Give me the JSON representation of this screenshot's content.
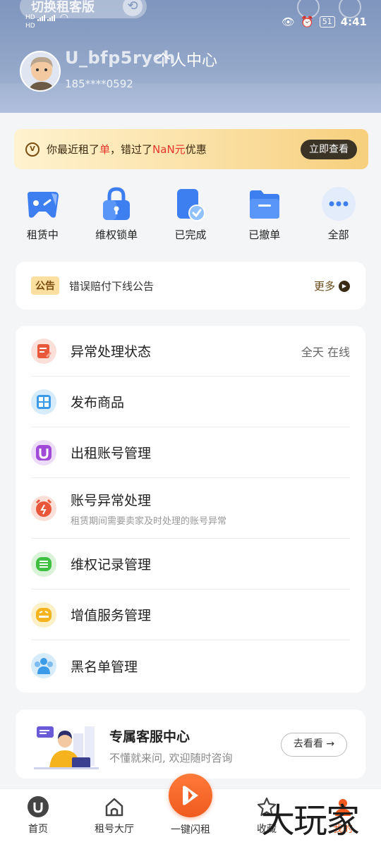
{
  "status_bar": {
    "time": "4:41",
    "battery": "51",
    "network_top": "HD",
    "network_bottom": "HD"
  },
  "header": {
    "switch_label": "切换租客版",
    "username": "U_bfp5rych",
    "title": "个人中心",
    "phone": "185****0592"
  },
  "promo": {
    "text_prefix": "你最近租了",
    "text_red1": "单",
    "text_mid": "，错过了",
    "text_red2": "NaN元",
    "text_suffix": "优惠",
    "button": "立即查看",
    "icon_label": "V"
  },
  "quick_actions": [
    {
      "label": "租赁中",
      "icon": "gamepad-icon"
    },
    {
      "label": "维权锁单",
      "icon": "lock-icon"
    },
    {
      "label": "已完成",
      "icon": "check-document-icon"
    },
    {
      "label": "已撤单",
      "icon": "folder-icon"
    },
    {
      "label": "全部",
      "icon": "more-dots-icon"
    }
  ],
  "notice": {
    "tag": "公告",
    "text": "错误赔付下线公告",
    "more": "更多"
  },
  "menu": [
    {
      "label": "异常处理状态",
      "right": "全天 在线",
      "icon": "edit-document-icon"
    },
    {
      "label": "发布商品",
      "icon": "grid-icon"
    },
    {
      "label": "出租账号管理",
      "icon": "u-logo-icon"
    },
    {
      "label": "账号异常处理",
      "sub": "租赁期间需要卖家及时处理的账号异常",
      "icon": "alarm-icon"
    },
    {
      "label": "维权记录管理",
      "icon": "list-icon"
    },
    {
      "label": "增值服务管理",
      "icon": "service-icon"
    },
    {
      "label": "黑名单管理",
      "icon": "users-icon"
    }
  ],
  "service": {
    "title": "专属客服中心",
    "subtitle": "不懂就来问, 欢迎随时咨询",
    "button": "去看看 →"
  },
  "bottom_nav": [
    {
      "label": "首页",
      "icon": "home-logo-icon"
    },
    {
      "label": "租号大厅",
      "icon": "house-icon"
    },
    {
      "label": "一键闪租",
      "icon": "flash-rent-icon"
    },
    {
      "label": "收藏",
      "icon": "star-icon"
    },
    {
      "label": "我的",
      "icon": "profile-icon"
    }
  ],
  "watermark": "大玩家",
  "colors": {
    "header": "#8ea3c6",
    "accent_orange": "#f05a1e",
    "promo_button": "#3a3326",
    "promo_red": "#e5352b"
  }
}
